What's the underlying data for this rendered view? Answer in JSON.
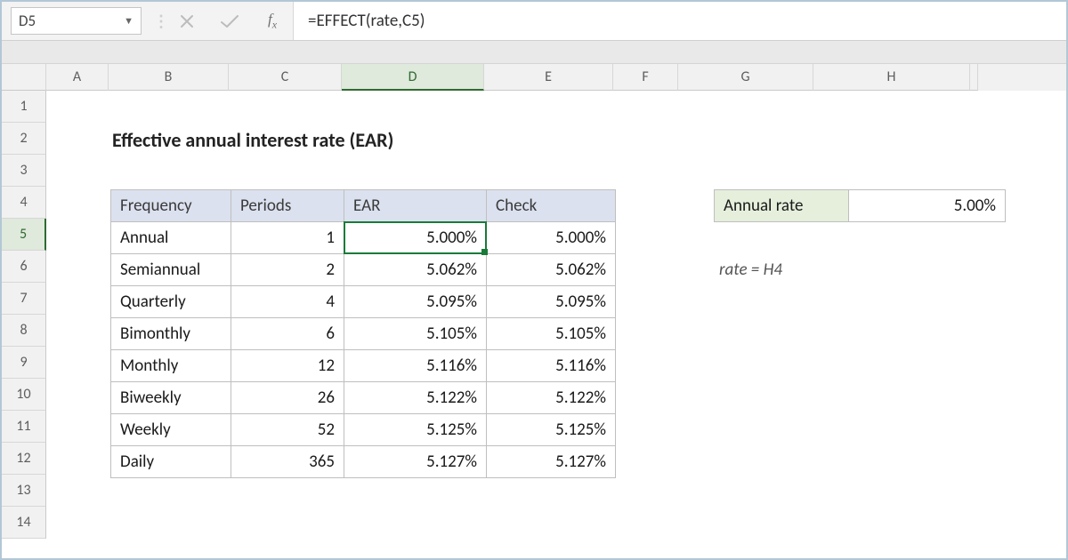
{
  "formula_bar": {
    "cell_ref": "D5",
    "formula": "=EFFECT(rate,C5)"
  },
  "columns": [
    "A",
    "B",
    "C",
    "D",
    "E",
    "F",
    "G",
    "H"
  ],
  "selected_col": "D",
  "rows": [
    "1",
    "2",
    "3",
    "4",
    "5",
    "6",
    "7",
    "8",
    "9",
    "10",
    "11",
    "12",
    "13",
    "14"
  ],
  "selected_row": "5",
  "title": "Effective annual interest rate (EAR)",
  "headers": {
    "frequency": "Frequency",
    "periods": "Periods",
    "ear": "EAR",
    "check": "Check"
  },
  "data": [
    {
      "frequency": "Annual",
      "periods": "1",
      "ear": "5.000%",
      "check": "5.000%"
    },
    {
      "frequency": "Semiannual",
      "periods": "2",
      "ear": "5.062%",
      "check": "5.062%"
    },
    {
      "frequency": "Quarterly",
      "periods": "4",
      "ear": "5.095%",
      "check": "5.095%"
    },
    {
      "frequency": "Bimonthly",
      "periods": "6",
      "ear": "5.105%",
      "check": "5.105%"
    },
    {
      "frequency": "Monthly",
      "periods": "12",
      "ear": "5.116%",
      "check": "5.116%"
    },
    {
      "frequency": "Biweekly",
      "periods": "26",
      "ear": "5.122%",
      "check": "5.122%"
    },
    {
      "frequency": "Weekly",
      "periods": "52",
      "ear": "5.125%",
      "check": "5.125%"
    },
    {
      "frequency": "Daily",
      "periods": "365",
      "ear": "5.127%",
      "check": "5.127%"
    }
  ],
  "annual_rate": {
    "label": "Annual rate",
    "value": "5.00%"
  },
  "rate_note": "rate = H4",
  "chart_data": {
    "type": "table",
    "title": "Effective annual interest rate (EAR)",
    "columns": [
      "Frequency",
      "Periods",
      "EAR",
      "Check"
    ],
    "rows": [
      [
        "Annual",
        1,
        "5.000%",
        "5.000%"
      ],
      [
        "Semiannual",
        2,
        "5.062%",
        "5.062%"
      ],
      [
        "Quarterly",
        4,
        "5.095%",
        "5.095%"
      ],
      [
        "Bimonthly",
        6,
        "5.105%",
        "5.105%"
      ],
      [
        "Monthly",
        12,
        "5.116%",
        "5.116%"
      ],
      [
        "Biweekly",
        26,
        "5.122%",
        "5.122%"
      ],
      [
        "Weekly",
        52,
        "5.125%",
        "5.125%"
      ],
      [
        "Daily",
        365,
        "5.127%",
        "5.127%"
      ]
    ],
    "parameters": {
      "Annual rate": "5.00%",
      "rate": "H4"
    }
  }
}
